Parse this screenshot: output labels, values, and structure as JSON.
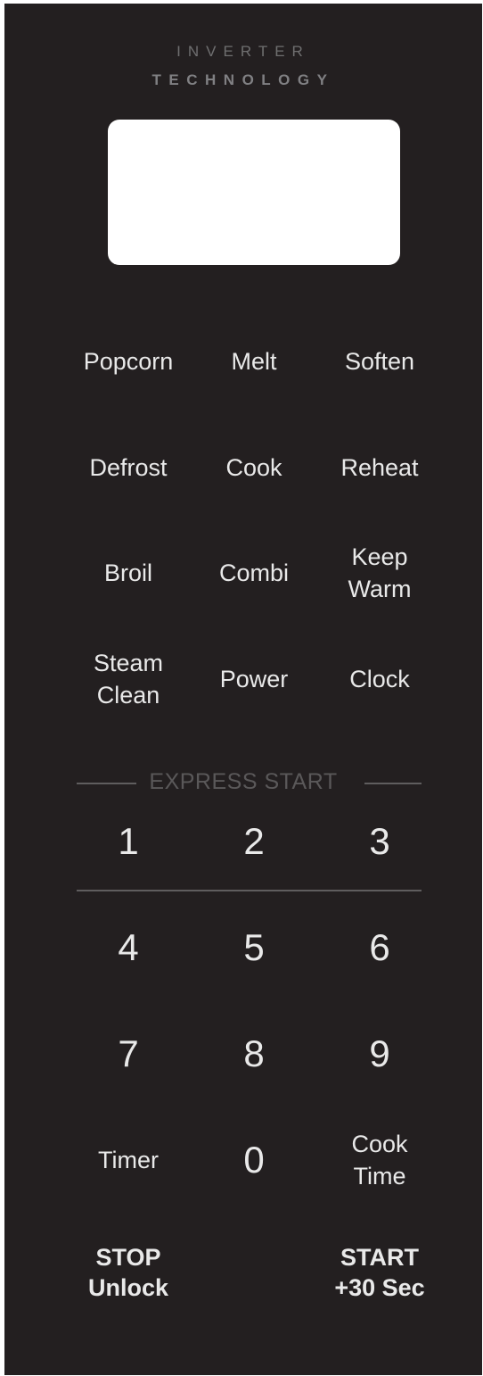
{
  "brand": {
    "line1": "INVERTER",
    "line2": "TECHNOLOGY"
  },
  "display": {
    "text": ""
  },
  "function_keys": {
    "popcorn": "Popcorn",
    "melt": "Melt",
    "soften": "Soften",
    "defrost": "Defrost",
    "cook": "Cook",
    "reheat": "Reheat",
    "broil": "Broil",
    "combi": "Combi",
    "keep_warm": [
      "Keep",
      "Warm"
    ],
    "steam_clean": [
      "Steam",
      "Clean"
    ],
    "power": "Power",
    "clock": "Clock"
  },
  "express_start": {
    "label": "EXPRESS START"
  },
  "number_keys": [
    "0",
    "1",
    "2",
    "3",
    "4",
    "5",
    "6",
    "7",
    "8",
    "9"
  ],
  "bottom_keys": {
    "timer": "Timer",
    "cook_time": [
      "Cook",
      "Time"
    ],
    "stop_unlock": [
      "STOP",
      "Unlock"
    ],
    "start_30": [
      "START",
      "+30 Sec"
    ]
  },
  "colors": {
    "panel": "#231f20",
    "key_text": "#e9e9e9",
    "display": "#ffffff",
    "express_label": "#5a5859"
  }
}
